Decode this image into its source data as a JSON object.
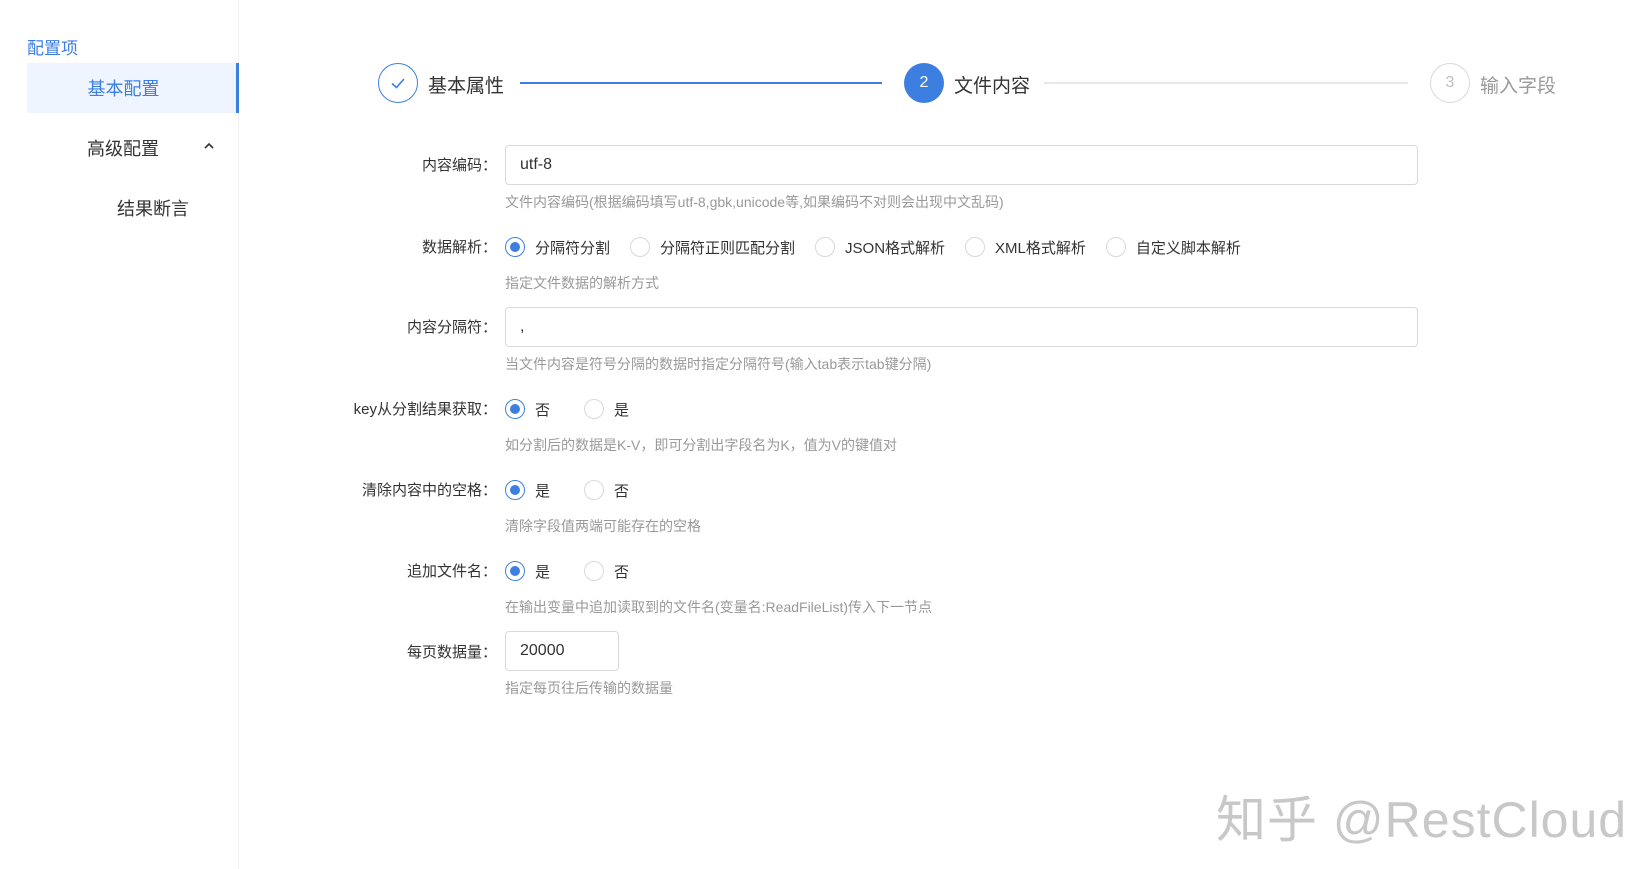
{
  "sidebar": {
    "title": "配置项",
    "items": [
      {
        "label": "基本配置"
      },
      {
        "label": "高级配置"
      },
      {
        "label": "结果断言"
      }
    ]
  },
  "steps": [
    {
      "index": "",
      "label": "基本属性",
      "status": "done"
    },
    {
      "index": "2",
      "label": "文件内容",
      "status": "current"
    },
    {
      "index": "3",
      "label": "输入字段",
      "status": "wait"
    }
  ],
  "form": {
    "encoding": {
      "label": "内容编码：",
      "value": "utf-8",
      "help": "文件内容编码(根据编码填写utf-8,gbk,unicode等,如果编码不对则会出现中文乱码)"
    },
    "parse": {
      "label": "数据解析：",
      "options": [
        "分隔符分割",
        "分隔符正则匹配分割",
        "JSON格式解析",
        "XML格式解析",
        "自定义脚本解析"
      ],
      "selected": "分隔符分割",
      "help": "指定文件数据的解析方式"
    },
    "separator": {
      "label": "内容分隔符：",
      "value": ",",
      "help": "当文件内容是符号分隔的数据时指定分隔符号(输入tab表示tab键分隔)"
    },
    "key_from_split": {
      "label": "key从分割结果获取：",
      "options": [
        "否",
        "是"
      ],
      "selected": "否",
      "help": "如分割后的数据是K-V，即可分割出字段名为K，值为V的键值对"
    },
    "trim_spaces": {
      "label": "清除内容中的空格：",
      "options": [
        "是",
        "否"
      ],
      "selected": "是",
      "help": "清除字段值两端可能存在的空格"
    },
    "append_filename": {
      "label": "追加文件名：",
      "options": [
        "是",
        "否"
      ],
      "selected": "是",
      "help": "在输出变量中追加读取到的文件名(变量名:ReadFileList)传入下一节点"
    },
    "page_size": {
      "label": "每页数据量：",
      "value": "20000",
      "help": "指定每页往后传输的数据量"
    }
  },
  "watermark": "知乎 @RestCloud",
  "colors": {
    "accent": "#3d7fe0",
    "help_text": "#999999",
    "border": "#d9d9d9"
  }
}
